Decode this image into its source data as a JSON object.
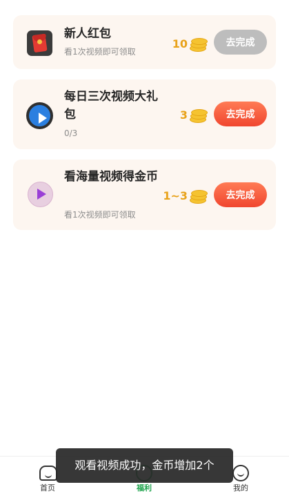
{
  "tasks": [
    {
      "title": "新人红包",
      "subtitle": "看1次视频即可领取",
      "reward": "10",
      "button": "去完成",
      "button_state": "disabled",
      "icon": "red-envelope-icon"
    },
    {
      "title": "每日三次视频大礼包",
      "subtitle": "0/3",
      "reward": "3",
      "button": "去完成",
      "button_state": "active",
      "icon": "blue-play-icon"
    },
    {
      "title": "看海量视频得金币",
      "subtitle": "看1次视频即可领取",
      "reward": "1~3",
      "button": "去完成",
      "button_state": "active",
      "icon": "purple-play-icon"
    }
  ],
  "nav": {
    "items": [
      {
        "label": "首页",
        "icon": "home-icon",
        "active": false
      },
      {
        "label": "福利",
        "icon": "welfare-icon",
        "active": true
      },
      {
        "label": "我的",
        "icon": "profile-icon",
        "active": false
      }
    ]
  },
  "toast": {
    "message": "观看视频成功，金币增加2个"
  },
  "colors": {
    "card_bg": "#fdf6f0",
    "button_active": "#f0462f",
    "button_disabled": "#bdbdbd",
    "reward_gold": "#e8a21a",
    "nav_active": "#1ea34c"
  }
}
